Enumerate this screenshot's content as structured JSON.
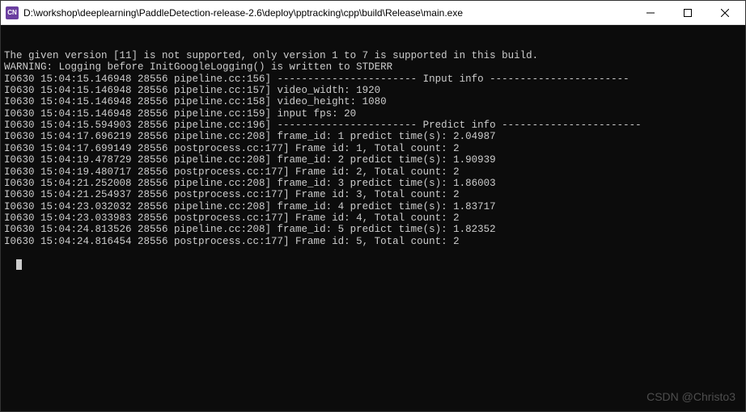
{
  "window": {
    "title": "D:\\workshop\\deeplearning\\PaddleDetection-release-2.6\\deploy\\pptracking\\cpp\\build\\Release\\main.exe",
    "icon_label": "CN"
  },
  "terminal": {
    "lines": [
      "The given version [11] is not supported, only version 1 to 7 is supported in this build.",
      "WARNING: Logging before InitGoogleLogging() is written to STDERR",
      "I0630 15:04:15.146948 28556 pipeline.cc:156] ----------------------- Input info -----------------------",
      "I0630 15:04:15.146948 28556 pipeline.cc:157] video_width: 1920",
      "I0630 15:04:15.146948 28556 pipeline.cc:158] video_height: 1080",
      "I0630 15:04:15.146948 28556 pipeline.cc:159] input fps: 20",
      "I0630 15:04:15.594903 28556 pipeline.cc:196] ----------------------- Predict info -----------------------",
      "I0630 15:04:17.696219 28556 pipeline.cc:208] frame_id: 1 predict time(s): 2.04987",
      "I0630 15:04:17.699149 28556 postprocess.cc:177] Frame id: 1, Total count: 2",
      "I0630 15:04:19.478729 28556 pipeline.cc:208] frame_id: 2 predict time(s): 1.90939",
      "I0630 15:04:19.480717 28556 postprocess.cc:177] Frame id: 2, Total count: 2",
      "I0630 15:04:21.252008 28556 pipeline.cc:208] frame_id: 3 predict time(s): 1.86003",
      "I0630 15:04:21.254937 28556 postprocess.cc:177] Frame id: 3, Total count: 2",
      "I0630 15:04:23.032032 28556 pipeline.cc:208] frame_id: 4 predict time(s): 1.83717",
      "I0630 15:04:23.033983 28556 postprocess.cc:177] Frame id: 4, Total count: 2",
      "I0630 15:04:24.813526 28556 pipeline.cc:208] frame_id: 5 predict time(s): 1.82352",
      "I0630 15:04:24.816454 28556 postprocess.cc:177] Frame id: 5, Total count: 2"
    ]
  },
  "watermark": "CSDN @Christo3"
}
